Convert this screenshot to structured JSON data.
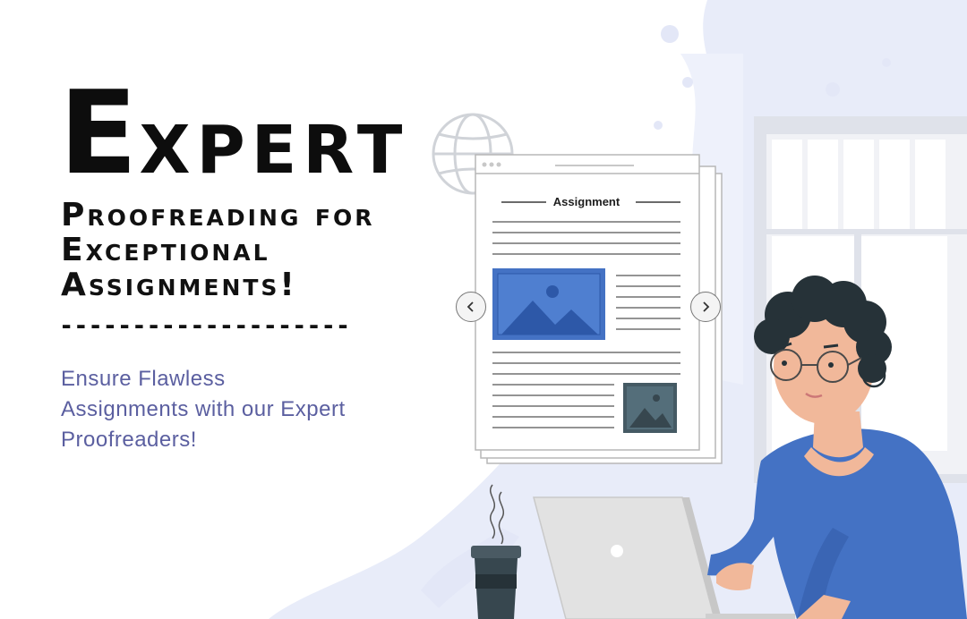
{
  "headline": {
    "first_letter": "E",
    "rest": "xpert",
    "subheading": "Proofreading for Exceptional Assignments!",
    "divider": "--------------------"
  },
  "tagline": "Ensure Flawless Assignments with our Expert Proofreaders!",
  "document": {
    "title": "Assignment"
  },
  "colors": {
    "accent_blue": "#4472c4",
    "tagline_text": "#5b5fa0",
    "hair": "#263238",
    "skin": "#f1b89a",
    "splash": "#e6eaf8"
  },
  "icons": [
    "globe-icon",
    "image-icon",
    "chevron-left-icon",
    "chevron-right-icon",
    "coffee-cup-icon",
    "laptop-icon"
  ]
}
